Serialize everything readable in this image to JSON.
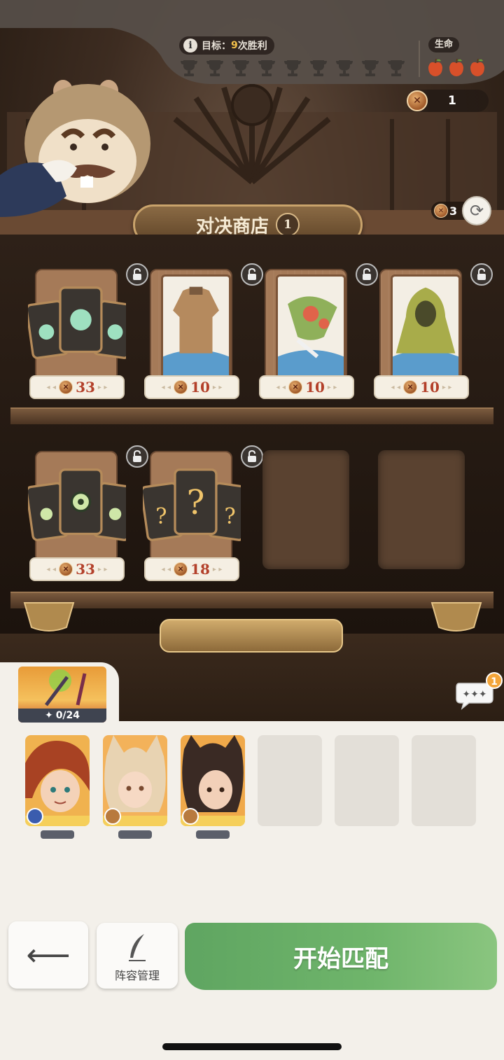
{
  "header": {
    "goal_prefix": "目标：",
    "goal_number": "9",
    "goal_suffix": "次胜利",
    "trophy_count": 9,
    "life_label": "生命",
    "lives": 3,
    "coins": "1"
  },
  "shop": {
    "title": "对决商店",
    "level": "1",
    "refresh_cost": "3"
  },
  "shelf_items": [
    {
      "name": "card-pack-green",
      "price": "33"
    },
    {
      "name": "leather-armor",
      "price": "10"
    },
    {
      "name": "flower-bouquet",
      "price": "10"
    },
    {
      "name": "leaf-cloak",
      "price": "10"
    },
    {
      "name": "card-pack-eye",
      "price": "33"
    },
    {
      "name": "card-pack-mystery",
      "price": "18"
    }
  ],
  "hero_progress": "0/24",
  "chat_badge": "1",
  "buttons": {
    "team_manage": "阵容管理",
    "start_match": "开始匹配"
  }
}
